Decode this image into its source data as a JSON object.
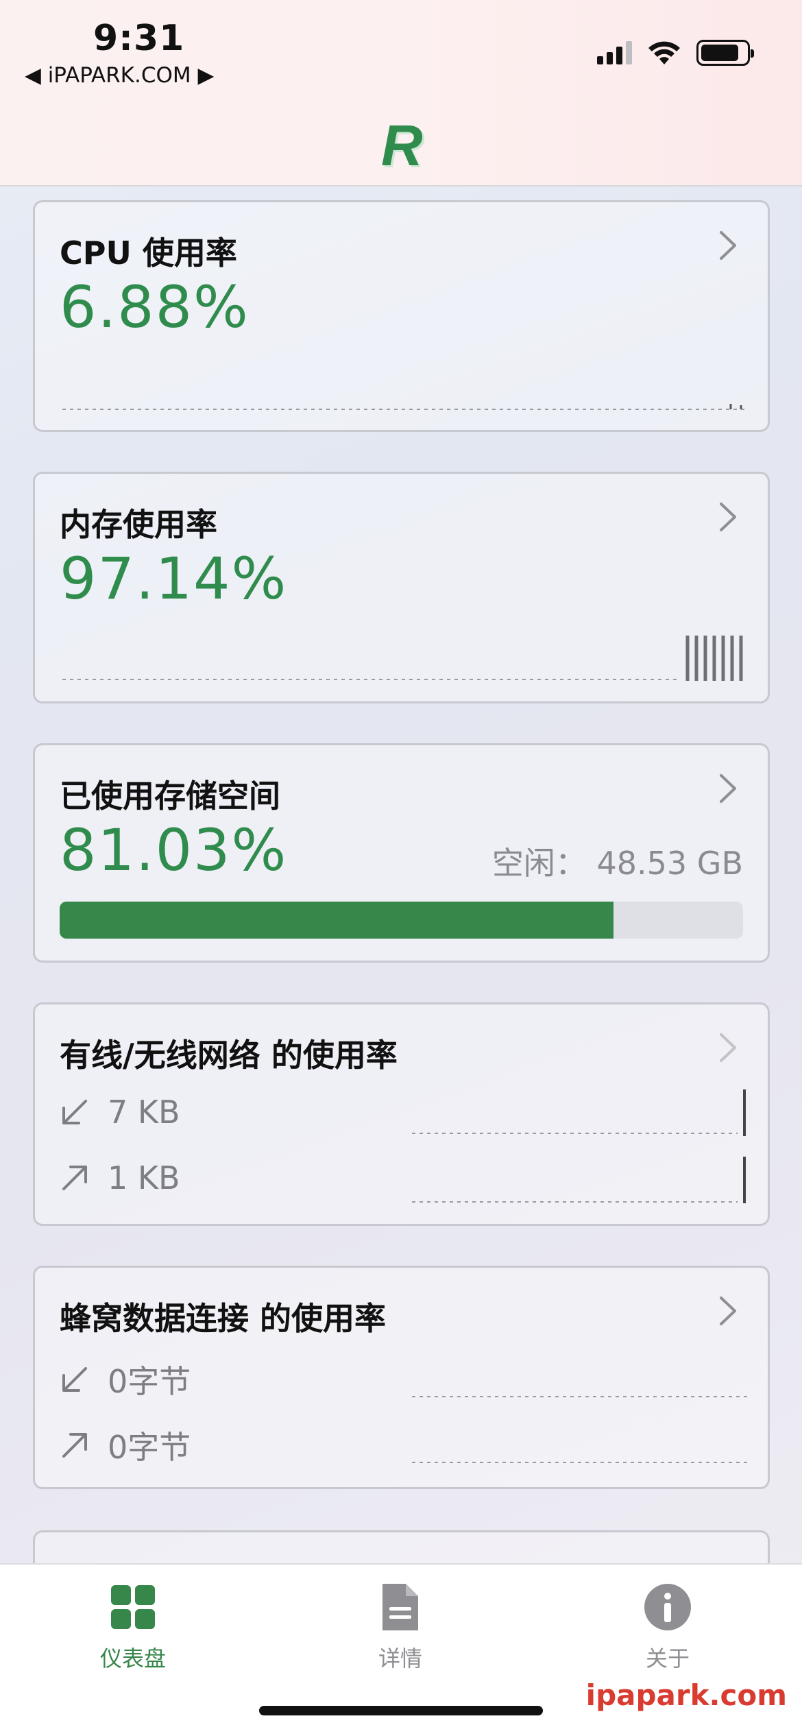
{
  "status_bar": {
    "time": "9:31",
    "back_label": "◀ iPAPARK.COM ▶"
  },
  "header": {
    "logo": "R"
  },
  "cards": {
    "cpu": {
      "title": "CPU 使用率",
      "value": "6.88%"
    },
    "memory": {
      "title": "内存使用率",
      "value": "97.14%"
    },
    "storage": {
      "title": "已使用存储空间",
      "value": "81.03%",
      "free": "空闲： 48.53 GB",
      "used_fraction": 0.8103
    },
    "wifi": {
      "title": "有线/无线网络 的使用率",
      "down": "7 KB",
      "up": "1 KB"
    },
    "cellular": {
      "title": "蜂窝数据连接 的使用率",
      "down": "0字节",
      "up": "0字节"
    }
  },
  "tabbar": {
    "dashboard": "仪表盘",
    "details": "详情",
    "about": "关于",
    "active_color": "#37874b",
    "inactive_color": "#8e8e93"
  },
  "watermark": "ipapark.com"
}
